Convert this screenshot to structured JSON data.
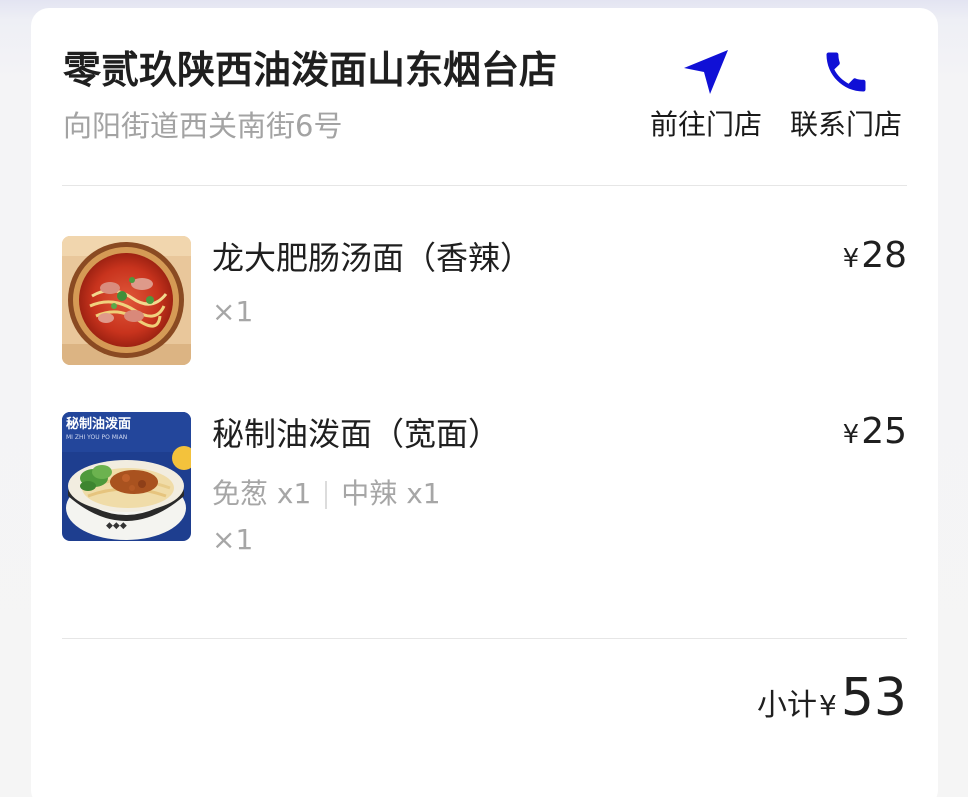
{
  "store": {
    "name": "零贰玖陕西油泼面山东烟台店",
    "address": "向阳街道西关南街6号"
  },
  "actions": {
    "navigate": {
      "label": "前往门店",
      "icon": "navigation-arrow-icon",
      "color": "#1010d6"
    },
    "call": {
      "label": "联系门店",
      "icon": "phone-icon",
      "color": "#1010d6"
    }
  },
  "items": [
    {
      "name": "龙大肥肠汤面（香辣）",
      "currency": "¥",
      "price": "28",
      "qty": "×1"
    },
    {
      "name": "秘制油泼面（宽面）",
      "currency": "¥",
      "price": "25",
      "specs": [
        "免葱 x1",
        "中辣 x1"
      ],
      "qty": "×1",
      "image_title": "秘制油泼面",
      "image_subtitle": "MI ZHI YOU PO MIAN"
    }
  ],
  "summary": {
    "label": "小计",
    "currency": "¥",
    "total": "53"
  }
}
